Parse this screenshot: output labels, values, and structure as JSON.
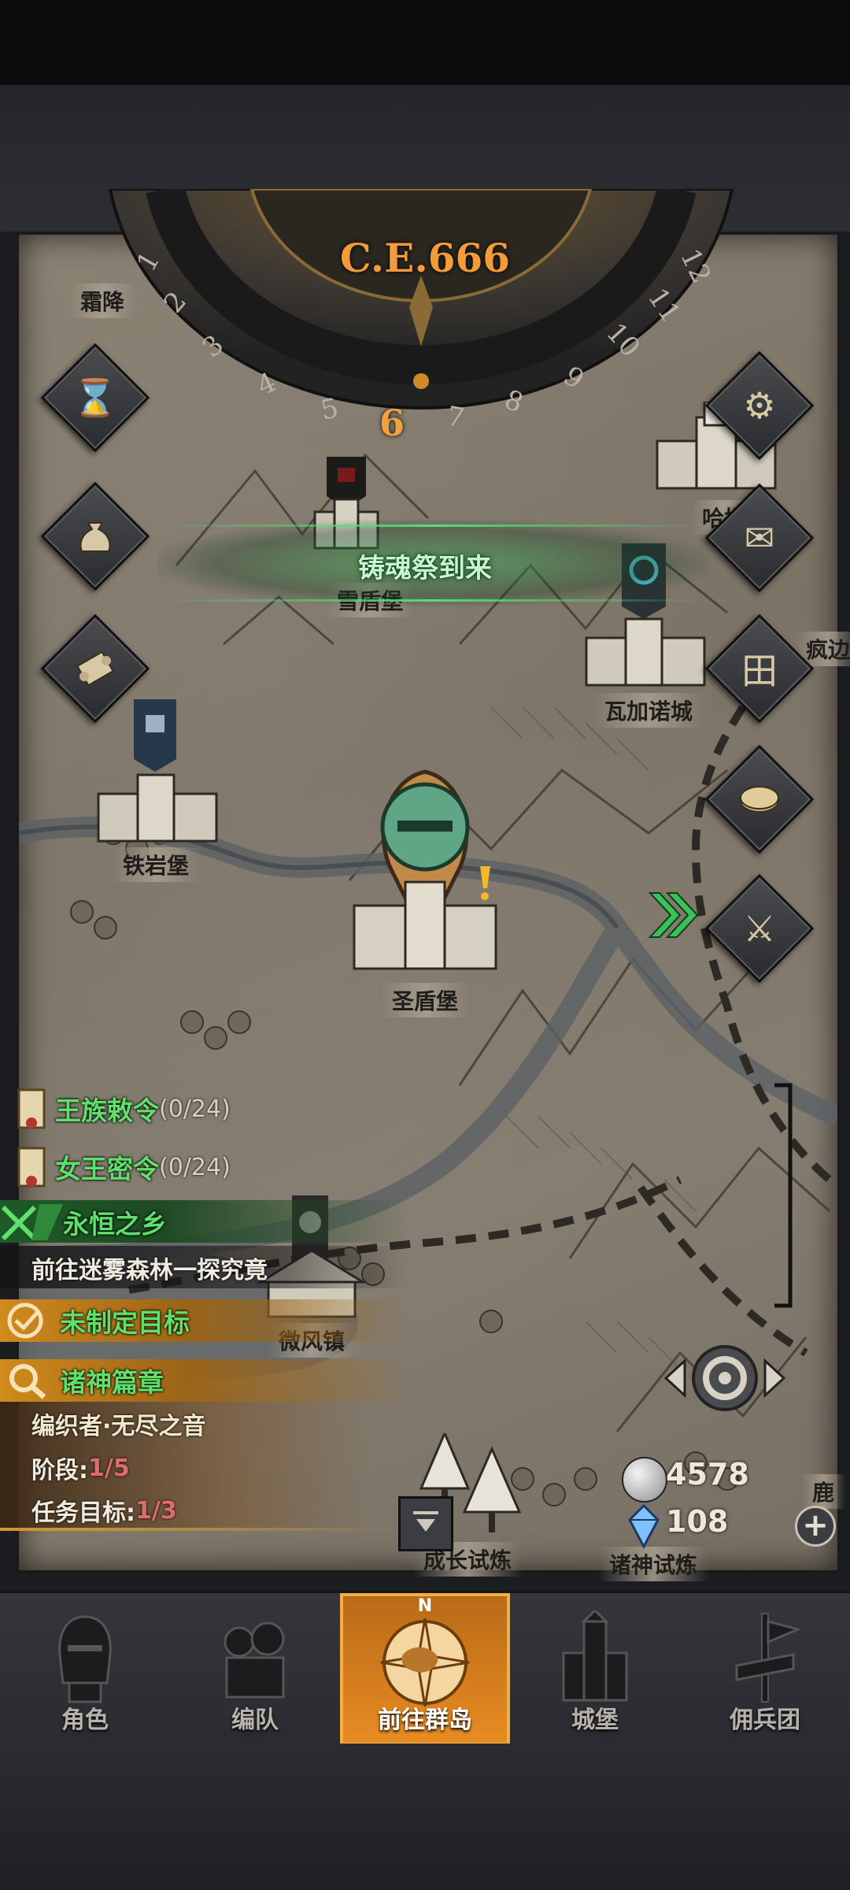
{
  "calendar": {
    "year": "C.E.666",
    "months": [
      "1",
      "2",
      "3",
      "4",
      "5",
      "6",
      "7",
      "8",
      "9",
      "10",
      "11",
      "12"
    ],
    "current_month": "6"
  },
  "event_banner": "铸魂祭到来",
  "map_labels": {
    "frost_fort": "霜降",
    "snow_shield_fort": "雪盾堡",
    "harbor_right": "哈坦",
    "wagano_city": "瓦加诺城",
    "border": "疯边",
    "iron_rock_fort": "铁岩堡",
    "holy_shield_fort": "圣盾堡",
    "breeze_town": "微风镇",
    "growth_trial": "成长试炼",
    "gods_trial": "诸神试炼",
    "far_right": "鹿"
  },
  "quests": {
    "royal_edict": {
      "label": "王族敕令",
      "count": "(0/24)"
    },
    "queen_secret": {
      "label": "女王密令",
      "count": "(0/24)"
    },
    "eternal_home": {
      "label": "永恒之乡",
      "desc": "前往迷雾森林一探究竟"
    },
    "no_goal": {
      "label": "未制定目标"
    },
    "gods_chapter": {
      "label": "诸神篇章",
      "subtitle": "编织者·无尽之音",
      "stage_label": "阶段:",
      "stage_value": "1/5",
      "target_label": "任务目标:",
      "target_value": "1/3"
    }
  },
  "resources": {
    "silver": "4578",
    "crystal": "108"
  },
  "tabs": [
    {
      "label": "角色"
    },
    {
      "label": "编队"
    },
    {
      "label": "前往群岛"
    },
    {
      "label": "城堡"
    },
    {
      "label": "佣兵团"
    }
  ],
  "active_tab": 2,
  "compass_letter": "N",
  "colors": {
    "accent_orange": "#e98c23",
    "quest_green": "#5ee06a",
    "year_orange": "#f39a3a"
  }
}
